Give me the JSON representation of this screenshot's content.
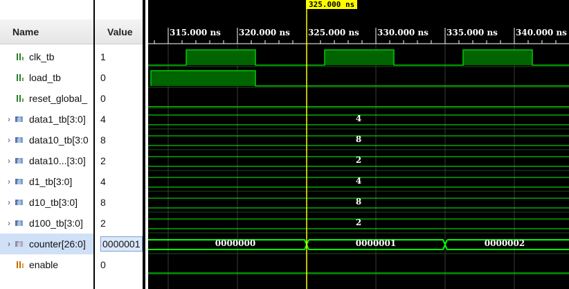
{
  "cursor": {
    "time_label": "325.000 ns"
  },
  "headers": {
    "name": "Name",
    "value": "Value"
  },
  "ticks": [
    "315.000 ns",
    "320.000 ns",
    "325.000 ns",
    "330.000 ns",
    "335.000 ns",
    "340.000 ns"
  ],
  "signals": [
    {
      "name": "clk_tb",
      "value": "1",
      "icon": "logic-signal-icon",
      "expandable": false
    },
    {
      "name": "load_tb",
      "value": "0",
      "icon": "logic-signal-icon",
      "expandable": false
    },
    {
      "name": "reset_global_",
      "value": "0",
      "icon": "logic-signal-icon",
      "expandable": false
    },
    {
      "name": "data1_tb[3:0]",
      "value": "4",
      "icon": "bus-signal-icon",
      "expandable": true,
      "bus_values": [
        "4"
      ]
    },
    {
      "name": "data10_tb[3:0",
      "value": "8",
      "icon": "bus-signal-icon",
      "expandable": true,
      "bus_values": [
        "8"
      ]
    },
    {
      "name": "data10...[3:0]",
      "value": "2",
      "icon": "bus-signal-icon",
      "expandable": true,
      "bus_values": [
        "2"
      ]
    },
    {
      "name": "d1_tb[3:0]",
      "value": "4",
      "icon": "bus-signal-icon",
      "expandable": true,
      "bus_values": [
        "4"
      ]
    },
    {
      "name": "d10_tb[3:0]",
      "value": "8",
      "icon": "bus-signal-icon",
      "expandable": true,
      "bus_values": [
        "8"
      ]
    },
    {
      "name": "d100_tb[3:0]",
      "value": "2",
      "icon": "bus-signal-icon",
      "expandable": true,
      "bus_values": [
        "2"
      ]
    },
    {
      "name": "counter[26:0]",
      "value": "0000001",
      "icon": "counter-bus-icon",
      "expandable": true,
      "selected": true,
      "bus_values": [
        "0000000",
        "0000001",
        "0000002"
      ]
    },
    {
      "name": "enable",
      "value": "0",
      "icon": "enable-signal-icon",
      "expandable": false
    }
  ],
  "colors": {
    "wave_green": "#00cc00",
    "high_fill": "#006400",
    "cursor": "#ffff00",
    "bus_line": "#00ff00",
    "selection": "#cfe0f7"
  }
}
